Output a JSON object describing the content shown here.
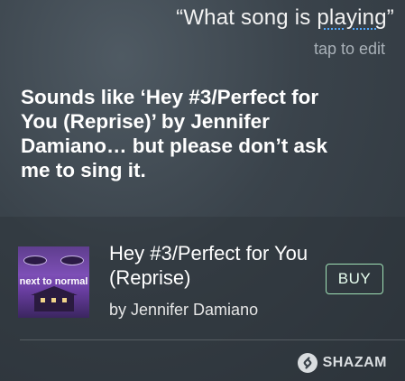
{
  "siri": {
    "query_open": "“What song is ",
    "query_underlined": "playing",
    "query_close": "”",
    "tap_to_edit": "tap to edit",
    "response": "Sounds like ‘Hey #3/Perfect for You (Reprise)’ by Jennifer Damiano… but please don’t ask me to sing it."
  },
  "result": {
    "album_art_text": "next to normal",
    "song_title": "Hey #3/Perfect for You (Reprise)",
    "artist": "by Jennifer Damiano",
    "buy_label": "BUY"
  },
  "footer": {
    "provider": "SHAZAM"
  },
  "colors": {
    "buy_border": "#9fe0b5",
    "album_purple": "#7d4fb6"
  },
  "icons": {
    "provider_logo": "shazam-icon"
  }
}
